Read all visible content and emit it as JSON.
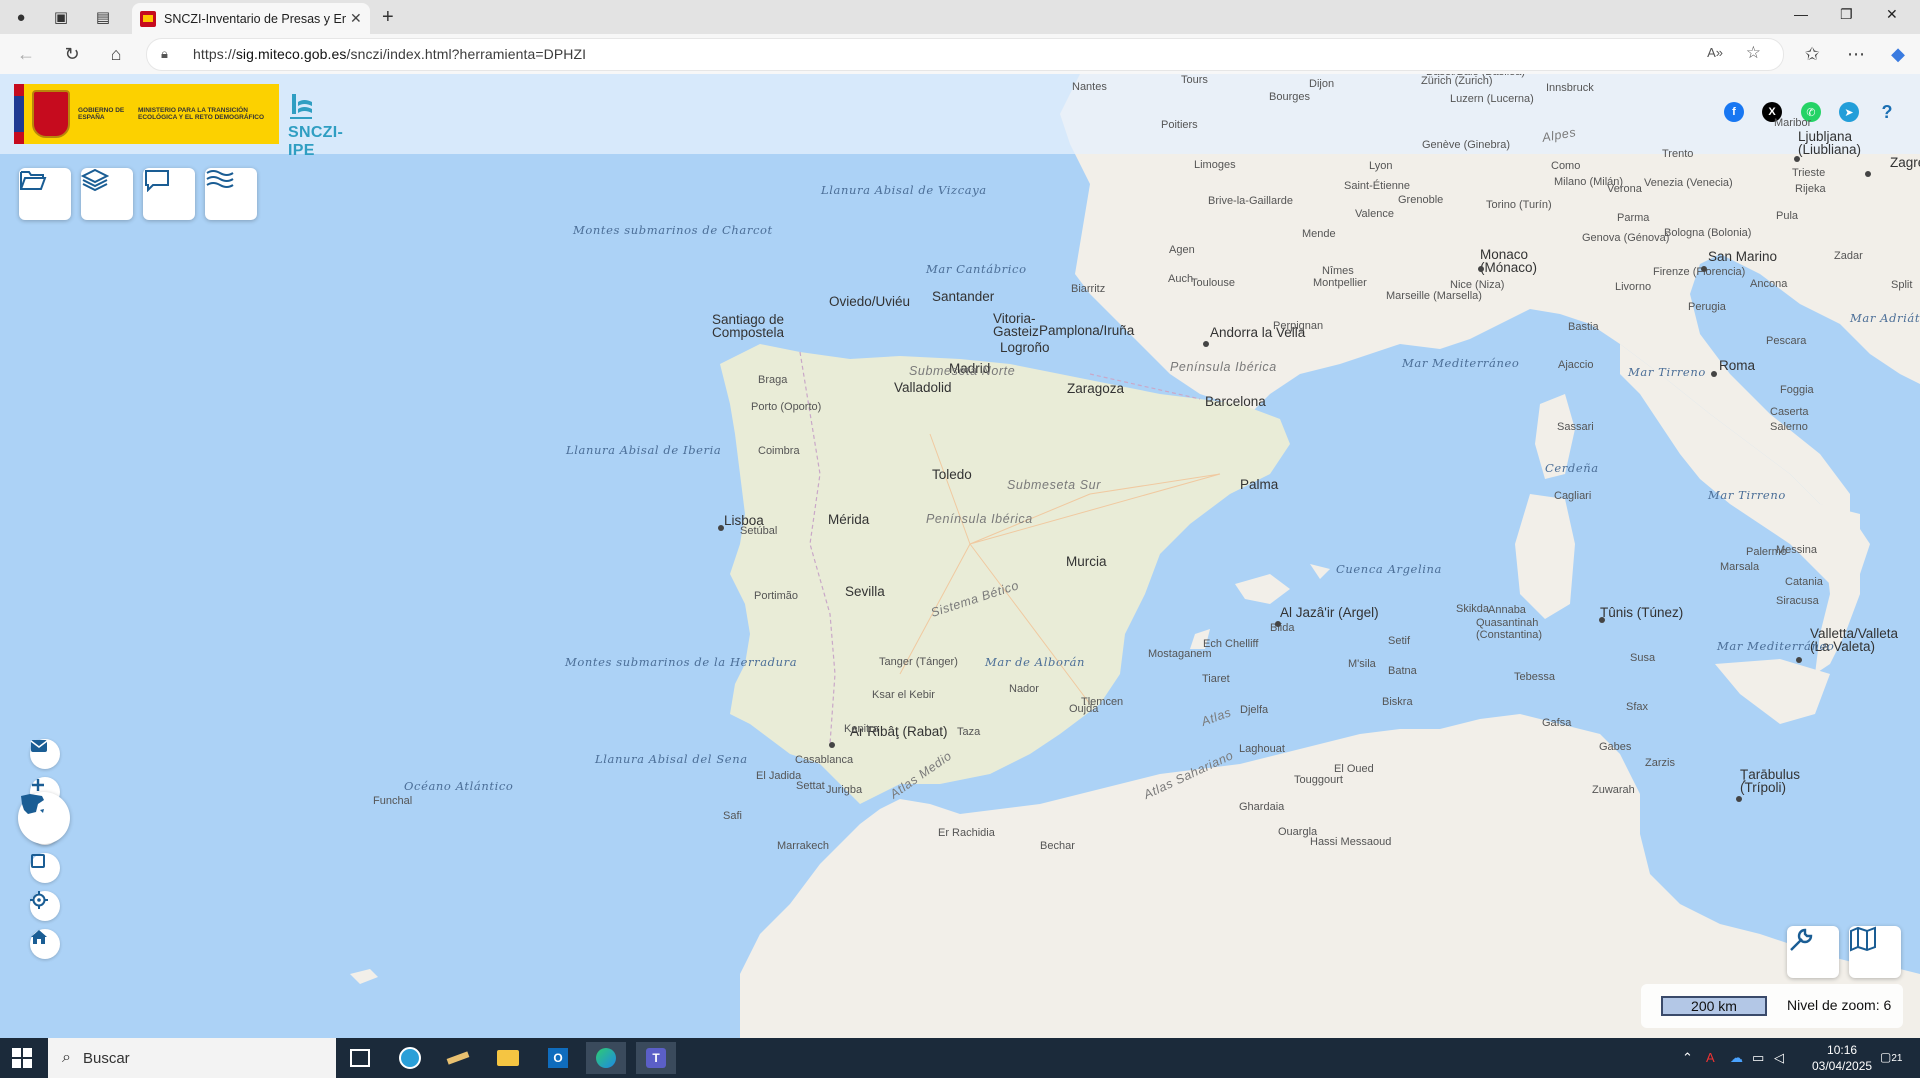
{
  "browser": {
    "tab_title": "SNCZI-Inventario de Presas y Emb",
    "url_domain": "sig.miteco.gob.es",
    "url_path": "/snczi/index.html?herramienta=DPHZI",
    "url_prefix": "https://"
  },
  "header": {
    "gov_name": "GOBIERNO DE ESPAÑA",
    "ministry": "MINISTERIO PARA LA TRANSICIÓN ECOLÓGICA Y EL RETO DEMOGRÁFICO",
    "app_name": "SNCZI-IPE",
    "share_icons": [
      "facebook-icon",
      "x-icon",
      "whatsapp-icon",
      "telegram-icon",
      "help-icon"
    ]
  },
  "toolbar": [
    "folder-icon",
    "layers-icon",
    "comment-icon",
    "water-icon"
  ],
  "map_controls": [
    "mail-icon",
    "zoom-in-icon",
    "zoom-out-icon",
    "extent-icon",
    "locate-icon",
    "home-icon"
  ],
  "scale": {
    "bar_label": "200 km",
    "zoom_label": "Nivel de zoom: 6"
  },
  "map_labels": {
    "cities_big": [
      {
        "text": "Madrid"
      },
      {
        "text": "Barcelona"
      },
      {
        "text": "Zaragoza"
      },
      {
        "text": "Valladolid"
      },
      {
        "text": "Sevilla"
      },
      {
        "text": "Toledo"
      },
      {
        "text": "Mérida"
      },
      {
        "text": "Murcia"
      },
      {
        "text": "Lisboa"
      },
      {
        "text": "Santander"
      },
      {
        "text": "Oviedo/Uviéu"
      },
      {
        "text": "Logroño"
      },
      {
        "text": "Pamplona/Iruña"
      },
      {
        "text": "Vitoria-\nGasteiz"
      },
      {
        "text": "Santiago de\nCompostela"
      },
      {
        "text": "Andorra la Vella"
      },
      {
        "text": "Palma"
      },
      {
        "text": "Roma"
      },
      {
        "text": "Monaco\n(Mónaco)"
      },
      {
        "text": "San Marino"
      },
      {
        "text": "Ljubljana\n(Liubliana)"
      },
      {
        "text": "Zagreb"
      },
      {
        "text": "Al Jazâ'ir (Argel)"
      },
      {
        "text": "Tûnis (Túnez)"
      },
      {
        "text": "Valletta/Valleta\n(La Valeta)"
      },
      {
        "text": "Ar Ribâţ (Rabat)"
      },
      {
        "text": "Ţarābulus\n(Trípoli)"
      }
    ],
    "cities_small": [
      "Braga",
      "Porto (Oporto)",
      "Coimbra",
      "Setúbal",
      "Portimão",
      "Tanger (Tánger)",
      "Ksar el Kebir",
      "Kenitra",
      "Casablanca",
      "El Jadida",
      "Settat",
      "Jurigba",
      "Safi",
      "Marrakech",
      "Er Rachidia",
      "Bechar",
      "Taza",
      "Nador",
      "Oujda",
      "Tlemcen",
      "Mostaganem",
      "Ech Chelliff",
      "Tiaret",
      "Djelfa",
      "Laghouat",
      "Ghardaia",
      "Ouargla",
      "Hassi Messaoud",
      "Touggourt",
      "El Oued",
      "Biskra",
      "Batna",
      "M'sila",
      "Setif",
      "Blida",
      "Skikda",
      "Annaba",
      "Quasantinah\n(Constantina)",
      "Tebessa",
      "Gafsa",
      "Sfax",
      "Gabes",
      "Zarzis",
      "Zuwarah",
      "Susa",
      "Palermo",
      "Messina",
      "Catania",
      "Siracusa",
      "Marsala",
      "Caserta",
      "Salerno",
      "Foggia",
      "Pescara",
      "Ancona",
      "Perugia",
      "Firenze (Florencia)",
      "Livorno",
      "Bastia",
      "Ajaccio",
      "Sassari",
      "Cagliari",
      "Bologna (Bolonia)",
      "Parma",
      "Genova (Génova)",
      "Torino (Turín)",
      "Milano (Milán)",
      "Verona",
      "Venezia (Venecia)",
      "Trento",
      "Como",
      "Trieste",
      "Rijeka",
      "Pula",
      "Zadar",
      "Split",
      "Nice (Niza)",
      "Marseille (Marsella)",
      "Montpellier",
      "Nîmes",
      "Valence",
      "Grenoble",
      "Saint-Étienne",
      "Lyon",
      "Genève (Ginebra)",
      "Brive-la-Gaillarde",
      "Limoges",
      "Mende",
      "Agen",
      "Auch",
      "Toulouse",
      "Biarritz",
      "Perpignan",
      "Poitiers",
      "Tours",
      "Nantes",
      "Bourges",
      "Dijon",
      "Basel/Bâle (Basilea)",
      "Zürich (Zurich)",
      "Luzern (Lucerna)",
      "Innsbruck",
      "Maribor",
      "Funchal"
    ],
    "seas": [
      "Llanura Abisal de Vizcaya",
      "Montes submarinos de Charcot",
      "Mar Cantábrico",
      "Llanura Abisal de Iberia",
      "Montes submarinos de la Herradura",
      "Llanura Abisal del Sena",
      "Océano Atlántico",
      "Mar de Alborán",
      "Mar Mediterráneo",
      "Mar Tirreno",
      "Cerdeña",
      "Cuenca Argelina",
      "Mar Mediterráneo",
      "Mar Adriático",
      "Mar Tirreno"
    ],
    "relief": [
      "Submeseta Norte",
      "Submeseta Sur",
      "Península Ibérica",
      "Península Ibérica",
      "Sistema Bético",
      "Alpes",
      "Atlas",
      "Atlas Medio",
      "Atlas Sahariano"
    ]
  },
  "taskbar": {
    "search_placeholder": "Buscar",
    "time": "10:16",
    "date": "03/04/2025",
    "notif_count": "21"
  },
  "colors": {
    "sea": "#acd2f6",
    "land": "#f2efe9",
    "iberia": "#e9ecd7",
    "spain_red": "#c60b1e",
    "spain_yellow": "#fcd100",
    "taskbar": "#1b2a3a"
  }
}
